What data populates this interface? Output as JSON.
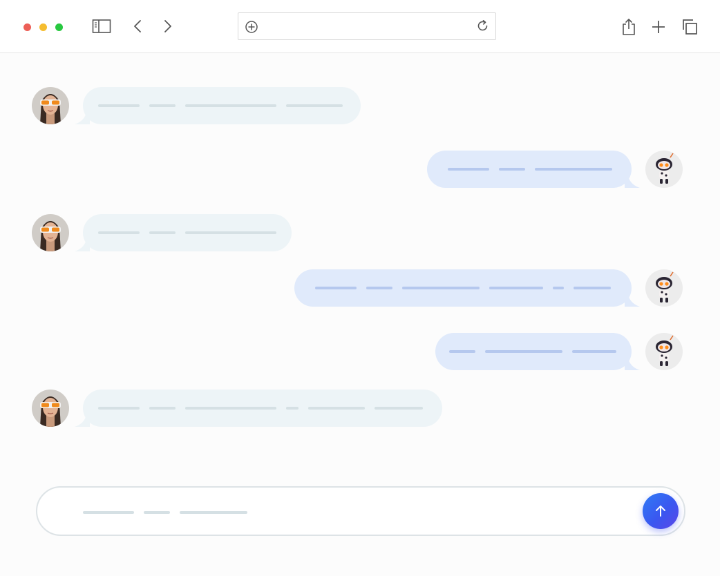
{
  "colors": {
    "close": "#ec5f57",
    "minimize": "#f5bd30",
    "maximize": "#28c840",
    "incoming_bubble": "#edf4f7",
    "outgoing_bubble": "#e0eafb",
    "send_button": "#3a57f0"
  },
  "toolbar": {
    "icons": [
      "sidebar-icon",
      "back-icon",
      "forward-icon",
      "share-icon",
      "new-tab-icon",
      "tabs-overview-icon"
    ],
    "address_bar": {
      "value": ""
    }
  },
  "avatars": {
    "user": "woman-with-orange-sunglasses",
    "bot": "robot"
  },
  "messages": [
    {
      "sender": "user",
      "placeholder_lines": 4
    },
    {
      "sender": "bot",
      "placeholder_lines": 3
    },
    {
      "sender": "user",
      "placeholder_lines": 3
    },
    {
      "sender": "bot",
      "placeholder_lines": 6
    },
    {
      "sender": "bot",
      "placeholder_lines": 3
    },
    {
      "sender": "user",
      "placeholder_lines": 6
    }
  ],
  "composer": {
    "placeholder_lines": 3,
    "send_icon": "arrow-up-icon"
  }
}
